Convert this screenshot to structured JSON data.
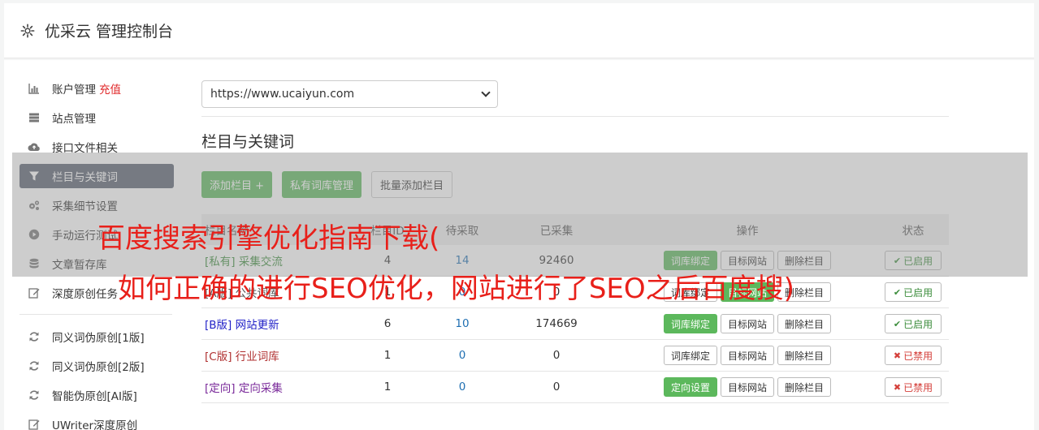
{
  "header": {
    "title": "优采云 管理控制台",
    "icon": "gear-icon"
  },
  "sidebar": {
    "items": [
      {
        "label": "账户管理",
        "extra": "充值",
        "icon": "bar-chart-icon"
      },
      {
        "label": "站点管理",
        "icon": "server-icon"
      },
      {
        "label": "接口文件相关",
        "icon": "cloud-upload-icon"
      },
      {
        "label": "栏目与关键词",
        "icon": "filter-icon",
        "active": true
      },
      {
        "label": "采集细节设置",
        "icon": "gears-icon"
      },
      {
        "label": "手动运行测试",
        "icon": "play-icon"
      },
      {
        "label": "文章暂存库",
        "icon": "database-icon"
      },
      {
        "label": "深度原创任务",
        "icon": "edit-icon"
      }
    ],
    "items2": [
      {
        "label": "同义词伪原创[1版]",
        "icon": "refresh-icon"
      },
      {
        "label": "同义词伪原创[2版]",
        "icon": "refresh-icon"
      },
      {
        "label": "智能伪原创[AI版]",
        "icon": "refresh-icon"
      },
      {
        "label": "UWriter深度原创",
        "icon": "edit-icon"
      }
    ]
  },
  "main": {
    "site_select": "https://www.ucaiyun.com",
    "section_title": "栏目与关键词",
    "toolbar": {
      "add_column": "添加栏目 +",
      "private_lib": "私有词库管理",
      "batch_add": "批量添加栏目"
    }
  },
  "table": {
    "headers": {
      "name": "栏目名称",
      "a": "栏目ID",
      "b": "待采取",
      "c": "已采集",
      "ops": "操作",
      "status": "状态"
    },
    "rows": [
      {
        "name": "[私有] 采集交流",
        "a": "4",
        "b": "14",
        "c": "92460",
        "op1": "词库绑定",
        "op2": "目标网站",
        "op3": "删除栏目",
        "status": "已启用",
        "enabled": true
      },
      {
        "name": "[A版] 公共词库",
        "a": "1",
        "b": "0",
        "c": "0",
        "op1": "词库绑定",
        "op2": "目标网站",
        "op3": "删除栏目",
        "status": "已启用",
        "enabled": true
      },
      {
        "name": "[B版] 网站更新",
        "a": "6",
        "b": "10",
        "c": "174669",
        "op1": "词库绑定",
        "op2": "目标网站",
        "op3": "删除栏目",
        "status": "已启用",
        "enabled": true
      },
      {
        "name": "[C版] 行业词库",
        "a": "1",
        "b": "0",
        "c": "0",
        "op1": "词库绑定",
        "op2": "目标网站",
        "op3": "删除栏目",
        "status": "已禁用",
        "enabled": false
      },
      {
        "name": "[定向] 定向采集",
        "a": "1",
        "b": "0",
        "c": "0",
        "op1": "定向设置",
        "op2": "目标网站",
        "op3": "删除栏目",
        "status": "已禁用",
        "enabled": false
      }
    ]
  },
  "overlay": {
    "line1": "百度搜索引擎优化指南下载(",
    "line2": "如何正确的进行SEO优化，网站进行了SEO之后百度搜)"
  },
  "colors": {
    "accent_green": "#5cb85c",
    "sidebar_active": "#596170",
    "spam_red": "#e8201a"
  }
}
